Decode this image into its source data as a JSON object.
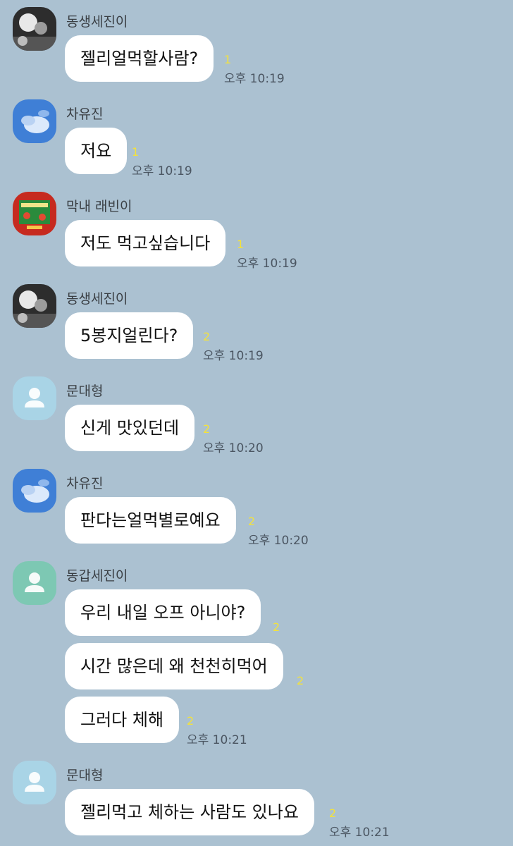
{
  "chat": {
    "groups": [
      {
        "sender": "동생세진이",
        "avatar": "photo-avatar-grayscale",
        "messages": [
          {
            "text": "젤리얼먹할사람?",
            "unread": "1",
            "time": "오후 10:19"
          }
        ]
      },
      {
        "sender": "차유진",
        "avatar": "photo-avatar-sky",
        "messages": [
          {
            "text": "저요",
            "unread": "1",
            "time": "오후 10:19"
          }
        ]
      },
      {
        "sender": "막내 래빈이",
        "avatar": "photo-avatar-red-frame",
        "messages": [
          {
            "text": "저도 먹고싶습니다",
            "unread": "1",
            "time": "오후 10:19"
          }
        ]
      },
      {
        "sender": "동생세진이",
        "avatar": "photo-avatar-grayscale",
        "messages": [
          {
            "text": "5봉지얼린다?",
            "unread": "2",
            "time": "오후 10:19"
          }
        ]
      },
      {
        "sender": "문대형",
        "avatar": "default-person-icon-lightblue",
        "messages": [
          {
            "text": "신게 맛있던데",
            "unread": "2",
            "time": "오후 10:20"
          }
        ]
      },
      {
        "sender": "차유진",
        "avatar": "photo-avatar-sky",
        "messages": [
          {
            "text": "판다는얼먹별로예요",
            "unread": "2",
            "time": "오후 10:20"
          }
        ]
      },
      {
        "sender": "동갑세진이",
        "avatar": "default-person-icon-teal",
        "messages": [
          {
            "text": "우리 내일 오프 아니야?",
            "unread": "2",
            "time": ""
          },
          {
            "text": "시간 많은데 왜 천천히먹어",
            "unread": "2",
            "time": ""
          },
          {
            "text": "그러다 체해",
            "unread": "2",
            "time": "오후 10:21"
          }
        ]
      },
      {
        "sender": "문대형",
        "avatar": "default-person-icon-lightblue",
        "messages": [
          {
            "text": "젤리먹고 체하는 사람도 있나요",
            "unread": "2",
            "time": "오후 10:21"
          }
        ]
      }
    ]
  },
  "colors": {
    "background": "#abc1d1",
    "bubble": "#ffffff",
    "unread": "#f3e23c",
    "time": "#4b5662",
    "default_avatar_lightblue": "#a9d4e6",
    "default_avatar_teal": "#7dc8b3"
  }
}
